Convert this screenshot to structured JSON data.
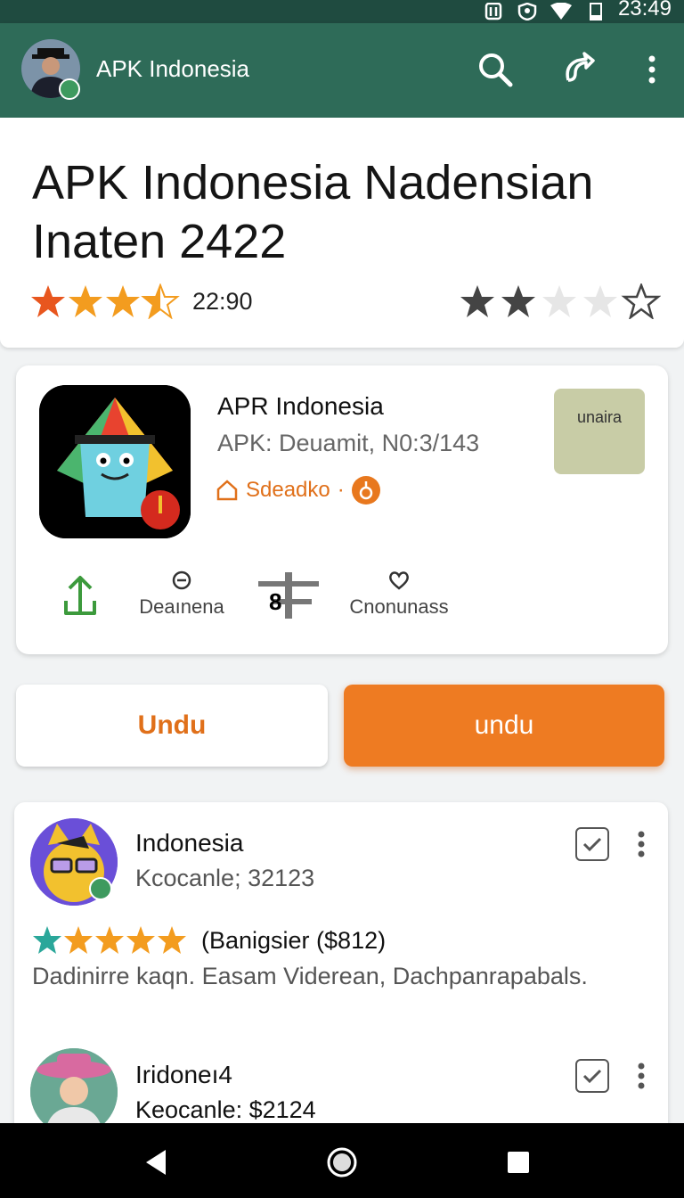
{
  "status_bar": {
    "time": "23:49",
    "icons": [
      "nfc-icon",
      "shield-icon",
      "wifi-icon",
      "battery-icon"
    ]
  },
  "app_bar": {
    "title": "APK Indonesia",
    "actions": [
      "search-icon",
      "share-icon",
      "more-vert-icon"
    ]
  },
  "header": {
    "title": "APK Indonesia Nadensian Inaten 2422",
    "rating_value": 3.5,
    "rating_text": "22:90",
    "secondary_rating_filled": 2,
    "secondary_rating_total": 5
  },
  "app_card": {
    "name": "APR Indonesia",
    "meta": "APK: Deuamit, N0:3/143",
    "developer": "Sdeadko",
    "thumbnail_label": "unaira",
    "stats": {
      "downloads_label": "Deaınena",
      "size_label": "8",
      "category_label": "Cnonunass"
    }
  },
  "buttons": {
    "secondary": "Undu",
    "primary": "undu"
  },
  "reviews": [
    {
      "name": "Indonesia",
      "subtitle": "Kcocanle; 32123",
      "stars": 5,
      "price": "(Banigsier ($812)",
      "text": "Dadinirre kaqn. Easam  Viderean, Dachpanrapabals."
    },
    {
      "name": "Iridoneı4",
      "subtitle": "Keocanle: $2124"
    }
  ],
  "colors": {
    "appbar": "#2e6b58",
    "statusbar": "#1f4b40",
    "accent": "#ee7b22",
    "star": "#f39c1f"
  },
  "nav_bar": {
    "buttons": [
      "back-icon",
      "home-icon",
      "recents-icon"
    ]
  }
}
